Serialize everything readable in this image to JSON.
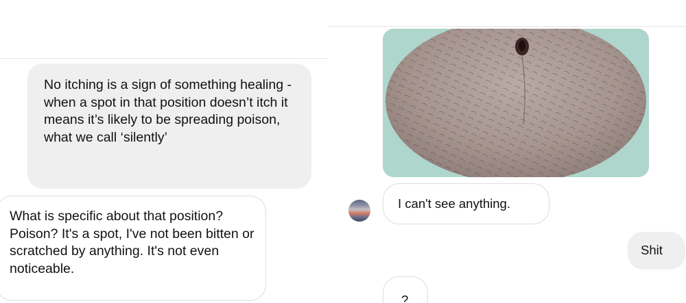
{
  "left_thread": {
    "messages": [
      {
        "text": "No itching is a sign of something healing - when a spot in that position doesn’t itch it means it’s likely to be spreading poison, what we call ‘silently’"
      },
      {
        "text": "What is specific about that position? Poison? It's a spot, I've not been bitten or scratched by anything. It's not even noticeable."
      }
    ]
  },
  "right_thread": {
    "messages": [
      {
        "text": "I can't see anything."
      },
      {
        "text": "Shit"
      },
      {
        "text": "?"
      }
    ]
  },
  "colors": {
    "received_bubble_bg": "#efefef",
    "sent_bubble_border": "#dddddd",
    "photo_background": "#aed6cc"
  }
}
